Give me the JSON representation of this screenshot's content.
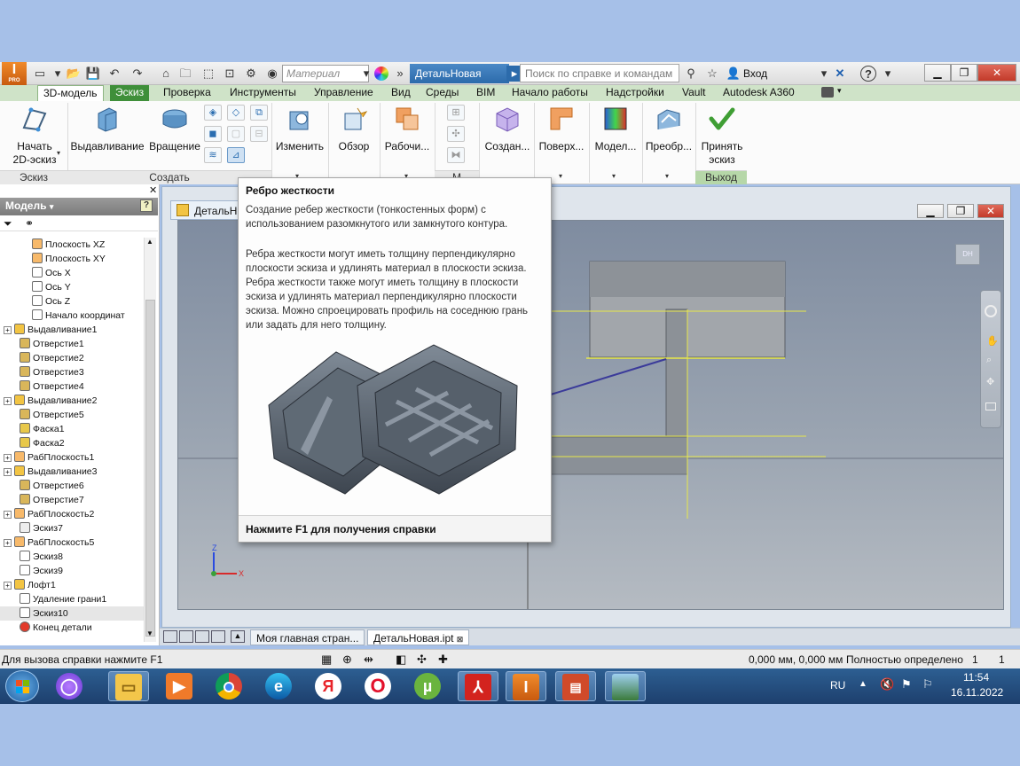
{
  "title_bar": {
    "app_badge": "PRO",
    "material_placeholder": "Материал",
    "document_title": "ДетальНовая",
    "search_placeholder": "Поиск по справке и командам",
    "login_label": "Вход",
    "help_label": "?"
  },
  "menu_tabs": [
    {
      "label": "3D-модель"
    },
    {
      "label": "Эскиз"
    },
    {
      "label": "Проверка"
    },
    {
      "label": "Инструменты"
    },
    {
      "label": "Управление"
    },
    {
      "label": "Вид"
    },
    {
      "label": "Среды"
    },
    {
      "label": "BIM"
    },
    {
      "label": "Начало работы"
    },
    {
      "label": "Надстройки"
    },
    {
      "label": "Vault"
    },
    {
      "label": "Autodesk A360"
    }
  ],
  "ribbon": {
    "start_sketch": "Начать\n2D-эскиз",
    "extrude": "Выдавливание",
    "revolve": "Вращение",
    "modify": "Изменить",
    "explore": "Обзор",
    "work": "Рабочи...",
    "create": "Создан...",
    "surface": "Поверх...",
    "model": "Модел...",
    "convert": "Преобр...",
    "finish_sketch": "Принять\nэскиз",
    "panel_sketch": "Эскиз",
    "panel_create": "Создать",
    "panel_exit": "Выход",
    "panel_m": "М"
  },
  "browser": {
    "header": "Модель",
    "items": [
      {
        "label": "Плоскость XZ",
        "indent": 2,
        "kind": "plane"
      },
      {
        "label": "Плоскость XY",
        "indent": 2,
        "kind": "plane"
      },
      {
        "label": "Ось X",
        "indent": 2,
        "kind": "axis"
      },
      {
        "label": "Ось Y",
        "indent": 2,
        "kind": "axis"
      },
      {
        "label": "Ось Z",
        "indent": 2,
        "kind": "axis"
      },
      {
        "label": "Начало координат",
        "indent": 2,
        "kind": "origin"
      },
      {
        "label": "Выдавливание1",
        "indent": 0,
        "kind": "feature",
        "exp": true
      },
      {
        "label": "Отверстие1",
        "indent": 1,
        "kind": "hole"
      },
      {
        "label": "Отверстие2",
        "indent": 1,
        "kind": "hole"
      },
      {
        "label": "Отверстие3",
        "indent": 1,
        "kind": "hole"
      },
      {
        "label": "Отверстие4",
        "indent": 1,
        "kind": "hole"
      },
      {
        "label": "Выдавливание2",
        "indent": 0,
        "kind": "feature",
        "exp": true
      },
      {
        "label": "Отверстие5",
        "indent": 1,
        "kind": "hole"
      },
      {
        "label": "Фаска1",
        "indent": 1,
        "kind": "chamfer"
      },
      {
        "label": "Фаска2",
        "indent": 1,
        "kind": "chamfer"
      },
      {
        "label": "РабПлоскость1",
        "indent": 0,
        "kind": "plane",
        "exp": true
      },
      {
        "label": "Выдавливание3",
        "indent": 0,
        "kind": "feature",
        "exp": true
      },
      {
        "label": "Отверстие6",
        "indent": 1,
        "kind": "hole"
      },
      {
        "label": "Отверстие7",
        "indent": 1,
        "kind": "hole"
      },
      {
        "label": "РабПлоскость2",
        "indent": 0,
        "kind": "plane",
        "exp": true
      },
      {
        "label": "Эскиз7",
        "indent": 1,
        "kind": "sketch_gray"
      },
      {
        "label": "РабПлоскость5",
        "indent": 0,
        "kind": "plane",
        "exp": true
      },
      {
        "label": "Эскиз8",
        "indent": 1,
        "kind": "sketch"
      },
      {
        "label": "Эскиз9",
        "indent": 1,
        "kind": "sketch"
      },
      {
        "label": "Лофт1",
        "indent": 0,
        "kind": "feature",
        "exp": true
      },
      {
        "label": "Удаление грани1",
        "indent": 1,
        "kind": "delete"
      },
      {
        "label": "Эскиз10",
        "indent": 1,
        "kind": "sketch",
        "active": true
      },
      {
        "label": "Конец детали",
        "indent": 1,
        "kind": "end"
      }
    ]
  },
  "document": {
    "tab_label": "ДетальН",
    "view_cube_label": "DH"
  },
  "tooltip": {
    "title": "Ребро жесткости",
    "para1": "Создание ребер жесткости (тонкостенных форм) с использованием разомкнутого или замкнутого контура.",
    "para2": "Ребра жесткости могут иметь толщину перпендикулярно плоскости эскиза и удлинять материал в плоскости эскиза. Ребра жесткости также могут иметь толщину в плоскости эскиза и удлинять материал перпендикулярно плоскости эскиза. Можно спроецировать профиль на соседнюю грань или задать для него толщину.",
    "footer": "Нажмите F1 для получения справки"
  },
  "doc_tabs": [
    {
      "label": "Моя главная стран..."
    },
    {
      "label": "ДетальНовая.ipt"
    }
  ],
  "status": {
    "help_hint": "Для вызова справки нажмите F1",
    "coords": "0,000 мм, 0,000 мм",
    "constraint_state": "Полностью определено",
    "count1": "1",
    "count2": "1"
  },
  "taskbar": {
    "language": "RU",
    "time": "11:54",
    "date": "16.11.2022",
    "apps": [
      "alice",
      "explorer",
      "media-player",
      "chrome",
      "edge",
      "yandex-browser",
      "opera",
      "utorrent",
      "acrobat",
      "inventor",
      "presentation",
      "photos"
    ]
  },
  "colors": {
    "ribbon_tab_green": "#3f8f3a",
    "doc_title_blue": "#2c6bab",
    "sketch_line_yellow": "#e8e84a",
    "sketch_line_blue": "#3b3b9a"
  }
}
